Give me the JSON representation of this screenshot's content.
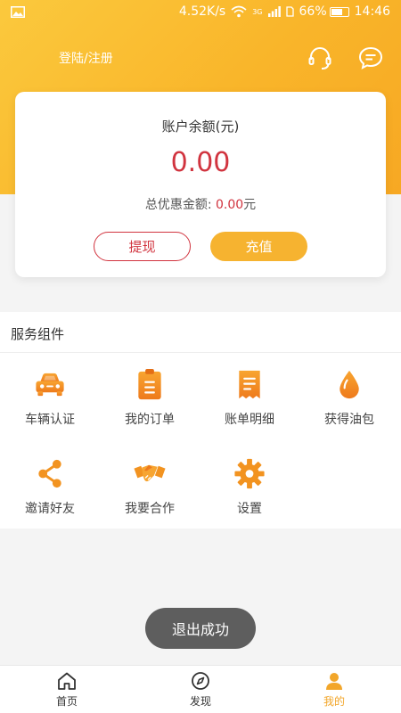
{
  "status_bar": {
    "network_speed": "4.52K/s",
    "network_type": "3G",
    "battery": "66%",
    "battery_level": 0.66,
    "time": "14:46"
  },
  "header": {
    "login_label": "登陆/注册",
    "support_icon": "headset-icon",
    "message_icon": "chat-bubble-icon"
  },
  "balance": {
    "title": "账户余额(元)",
    "amount": "0.00",
    "discount_label": "总优惠金额: ",
    "discount_value": "0.00",
    "discount_unit": "元",
    "withdraw_label": "提现",
    "recharge_label": "充值"
  },
  "services": {
    "title": "服务组件",
    "items": [
      {
        "label": "车辆认证",
        "icon": "car-icon"
      },
      {
        "label": "我的订单",
        "icon": "clipboard-icon"
      },
      {
        "label": "账单明细",
        "icon": "document-icon"
      },
      {
        "label": "获得油包",
        "icon": "oil-drop-icon"
      },
      {
        "label": "邀请好友",
        "icon": "share-icon"
      },
      {
        "label": "我要合作",
        "icon": "handshake-icon"
      },
      {
        "label": "设置",
        "icon": "gear-icon"
      }
    ]
  },
  "toast": "退出成功",
  "tabs": [
    {
      "label": "首页",
      "icon": "home-icon"
    },
    {
      "label": "发现",
      "icon": "compass-icon"
    },
    {
      "label": "我的",
      "icon": "person-icon",
      "active": true
    }
  ],
  "colors": {
    "brand_yellow": "#f9b52a",
    "accent_red": "#d1343f",
    "icon_orange": "#f29320",
    "active_tab": "#f2a62a"
  }
}
